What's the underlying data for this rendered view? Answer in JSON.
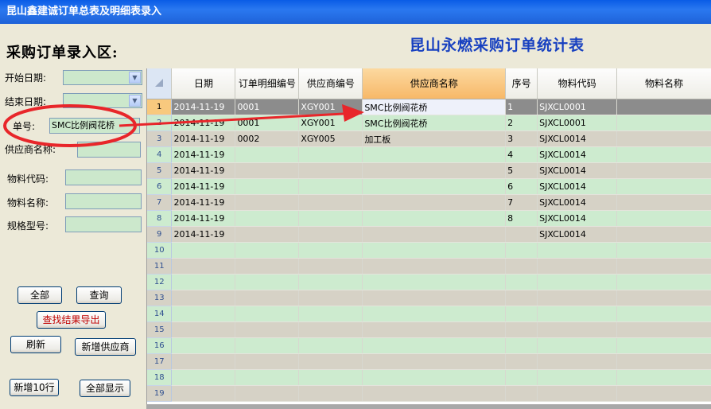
{
  "window": {
    "title": "昆山鑫建诚订单总表及明细表录入"
  },
  "left": {
    "section_title": "采购订单录入区:",
    "start_date_label": "开始日期:",
    "end_date_label": "结束日期:",
    "order_no_label": "单号:",
    "order_no_value": "SMC比例阀花桥",
    "supplier_name_label": "供应商名称:",
    "material_code_label": "物料代码:",
    "material_name_label": "物料名称:",
    "spec_label": "规格型号:"
  },
  "buttons": {
    "all": "全部",
    "query": "查询",
    "export": "查找结果导出",
    "refresh": "刷新",
    "add_supplier": "新增供应商",
    "add10": "新增10行",
    "show_all": "全部显示"
  },
  "report": {
    "title": "昆山永燃采购订单统计表"
  },
  "grid": {
    "columns": [
      "日期",
      "订单明细编号",
      "供应商编号",
      "供应商名称",
      "序号",
      "物料代码",
      "物料名称"
    ],
    "rows": [
      {
        "n": "1",
        "date": "2014-11-19",
        "detail": "0001",
        "sup": "XGY001",
        "name": "SMC比例阀花桥",
        "seq": "1",
        "code": "SJXCL0001",
        "mat": ""
      },
      {
        "n": "2",
        "date": "2014-11-19",
        "detail": "0001",
        "sup": "XGY001",
        "name": "SMC比例阀花桥",
        "seq": "2",
        "code": "SJXCL0001",
        "mat": ""
      },
      {
        "n": "3",
        "date": "2014-11-19",
        "detail": "0002",
        "sup": "XGY005",
        "name": "加工板",
        "seq": "3",
        "code": "SJXCL0014",
        "mat": ""
      },
      {
        "n": "4",
        "date": "2014-11-19",
        "detail": "",
        "sup": "",
        "name": "",
        "seq": "4",
        "code": "SJXCL0014",
        "mat": ""
      },
      {
        "n": "5",
        "date": "2014-11-19",
        "detail": "",
        "sup": "",
        "name": "",
        "seq": "5",
        "code": "SJXCL0014",
        "mat": ""
      },
      {
        "n": "6",
        "date": "2014-11-19",
        "detail": "",
        "sup": "",
        "name": "",
        "seq": "6",
        "code": "SJXCL0014",
        "mat": ""
      },
      {
        "n": "7",
        "date": "2014-11-19",
        "detail": "",
        "sup": "",
        "name": "",
        "seq": "7",
        "code": "SJXCL0014",
        "mat": ""
      },
      {
        "n": "8",
        "date": "2014-11-19",
        "detail": "",
        "sup": "",
        "name": "",
        "seq": "8",
        "code": "SJXCL0014",
        "mat": ""
      },
      {
        "n": "9",
        "date": "2014-11-19",
        "detail": "",
        "sup": "",
        "name": "",
        "seq": "",
        "code": "SJXCL0014",
        "mat": ""
      },
      {
        "n": "10",
        "date": "",
        "detail": "",
        "sup": "",
        "name": "",
        "seq": "",
        "code": "",
        "mat": ""
      },
      {
        "n": "11",
        "date": "",
        "detail": "",
        "sup": "",
        "name": "",
        "seq": "",
        "code": "",
        "mat": ""
      },
      {
        "n": "12",
        "date": "",
        "detail": "",
        "sup": "",
        "name": "",
        "seq": "",
        "code": "",
        "mat": ""
      },
      {
        "n": "13",
        "date": "",
        "detail": "",
        "sup": "",
        "name": "",
        "seq": "",
        "code": "",
        "mat": ""
      },
      {
        "n": "14",
        "date": "",
        "detail": "",
        "sup": "",
        "name": "",
        "seq": "",
        "code": "",
        "mat": ""
      },
      {
        "n": "15",
        "date": "",
        "detail": "",
        "sup": "",
        "name": "",
        "seq": "",
        "code": "",
        "mat": ""
      },
      {
        "n": "16",
        "date": "",
        "detail": "",
        "sup": "",
        "name": "",
        "seq": "",
        "code": "",
        "mat": ""
      },
      {
        "n": "17",
        "date": "",
        "detail": "",
        "sup": "",
        "name": "",
        "seq": "",
        "code": "",
        "mat": ""
      },
      {
        "n": "18",
        "date": "",
        "detail": "",
        "sup": "",
        "name": "",
        "seq": "",
        "code": "",
        "mat": ""
      },
      {
        "n": "19",
        "date": "",
        "detail": "",
        "sup": "",
        "name": "",
        "seq": "",
        "code": "",
        "mat": ""
      }
    ]
  },
  "annotation": {
    "color": "#E8262A"
  }
}
